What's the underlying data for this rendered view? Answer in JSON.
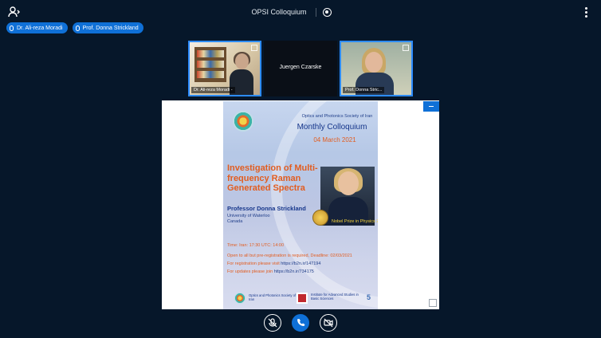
{
  "header": {
    "title": "OPSI Colloquium"
  },
  "talkers": [
    {
      "name": "Dr. Ali-reza Moradi"
    },
    {
      "name": "Prof. Donna Strickland"
    }
  ],
  "videos": [
    {
      "name": "Dr. Ali-reza Moradi -"
    },
    {
      "name": "Juergen Czarske"
    },
    {
      "name": "Prof. Donna Stric..."
    }
  ],
  "poster": {
    "society": "Optics and Photonics Society of Iran",
    "series": "Monthly Colloquium",
    "date": "04 March 2021",
    "talk_title": "Investigation of Multi-frequency Raman Generated Spectra",
    "speaker": "Professor Donna Strickland",
    "affiliation_1": "University of Waterloo",
    "affiliation_2": "Canada",
    "nobel": "Nobel Prize in Physics 2018",
    "time": "Time: Iran: 17:30    UTC: 14:00",
    "registration_note": "Open to all but pre-registration is required, Deadline: 02/03/2021",
    "registration_label": "For registration please visit ",
    "registration_link": "https://b2n.ir/147194",
    "updates_label": "For updates please join ",
    "updates_link": "https://b2n.ir/734175",
    "footer_society": "Optics and Photonics Society of Iran",
    "footer_institute": "Institute for Advanced Studies in Basic Sciences",
    "footer_number": "5"
  },
  "colors": {
    "accent": "#0f70d7",
    "background": "#06172a",
    "poster_orange": "#e25d20",
    "poster_blue": "#16368b"
  },
  "icons": [
    "users-icon",
    "record-icon",
    "options-icon",
    "mic-icon",
    "expand-icon",
    "minimize-icon",
    "fullscreen-icon",
    "mute-icon",
    "phone-icon",
    "camera-off-icon"
  ]
}
